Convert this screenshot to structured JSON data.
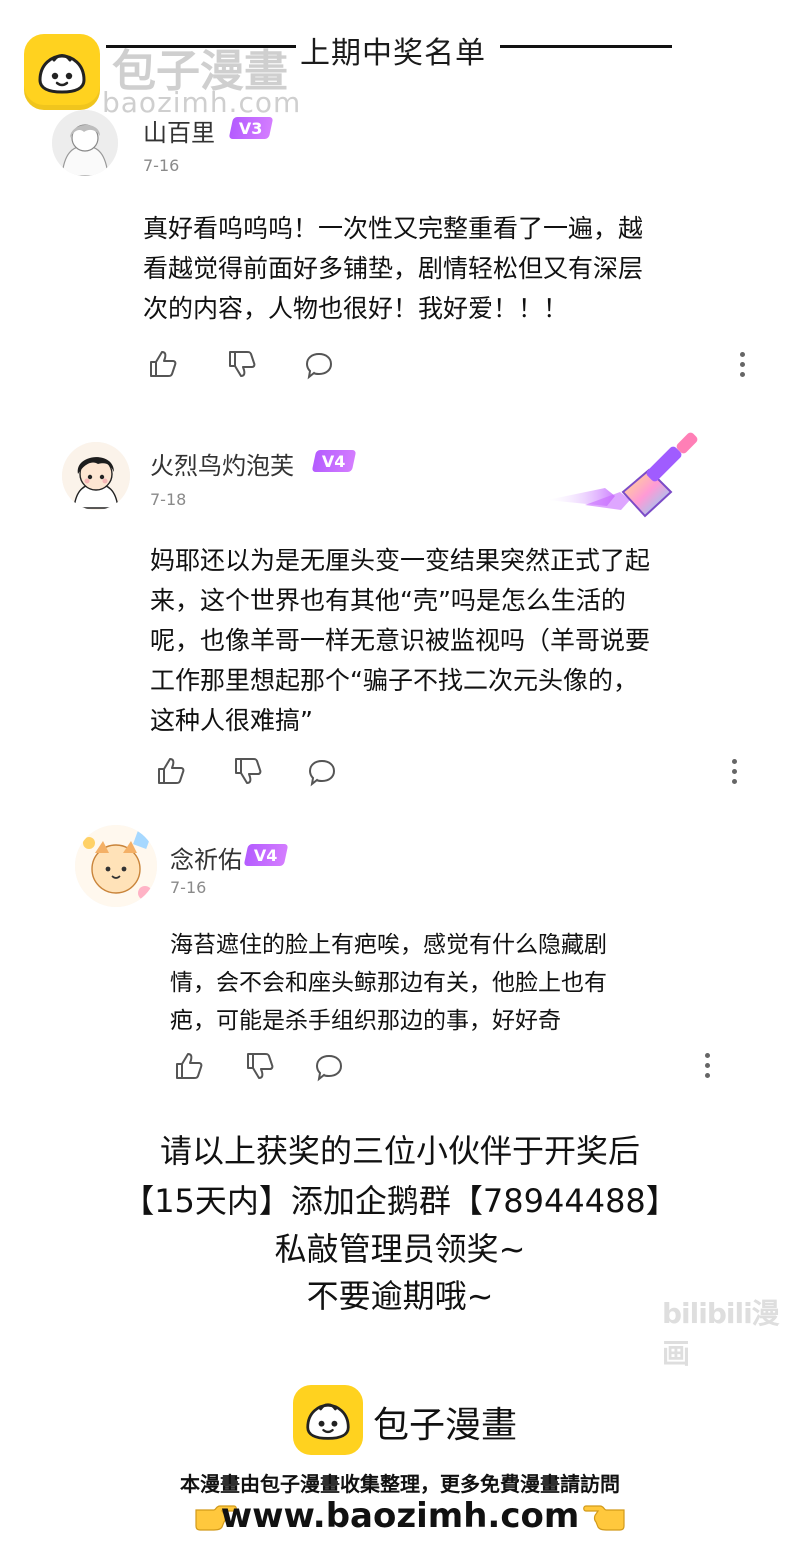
{
  "header": {
    "title": "上期中奖名单"
  },
  "watermark": {
    "brand": "包子漫畫",
    "url": "baozimh.com",
    "logo_color": "#ffd21f"
  },
  "comments": [
    {
      "user": "山百里",
      "badge": "V3",
      "date": "7-16",
      "text_lines": [
        "真好看呜呜呜！一次性又完整重看了一遍，越",
        "看越觉得前面好多铺垫，剧情轻松但又有深层",
        "次的内容，人物也很好！我好爱！！！"
      ],
      "icons": [
        "thumbs-up-icon",
        "thumbs-down-icon",
        "comment-icon",
        "more-icon"
      ]
    },
    {
      "user": "火烈鸟灼泡芙",
      "badge": "V4",
      "date": "7-18",
      "text_lines": [
        "妈耶还以为是无厘头变一变结果突然正式了起",
        "来，这个世界也有其他“壳”吗是怎么生活的",
        "呢，也像羊哥一样无意识被监视吗（羊哥说要",
        "工作那里想起那个“骗子不找二次元头像的，",
        "这种人很难搞”"
      ],
      "icons": [
        "thumbs-up-icon",
        "thumbs-down-icon",
        "comment-icon",
        "more-icon"
      ]
    },
    {
      "user": "念祈佑",
      "badge": "V4",
      "date": "7-16",
      "text_lines": [
        "海苔遮住的脸上有疤唉，感觉有什么隐藏剧",
        "情，会不会和座头鲸那边有关，他脸上也有",
        "疤，可能是杀手组织那边的事，好好奇"
      ],
      "icons": [
        "thumbs-up-icon",
        "thumbs-down-icon",
        "comment-icon",
        "more-icon"
      ]
    }
  ],
  "notice": {
    "lines": [
      "请以上获奖的三位小伙伴于开奖后",
      "【15天内】添加企鹅群【78944488】",
      "私敲管理员领奖~",
      "不要逾期哦~"
    ]
  },
  "bilibili_watermark": "bilibili漫画",
  "footer": {
    "brand": "包子漫畫",
    "description": "本漫畫由包子漫畫收集整理，更多免費漫畫請訪問",
    "url": "www.baozimh.com"
  },
  "colors": {
    "badge": "#c06bff",
    "brand_yellow": "#ffd21f",
    "text": "#111111",
    "muted": "#8a8a8a"
  }
}
